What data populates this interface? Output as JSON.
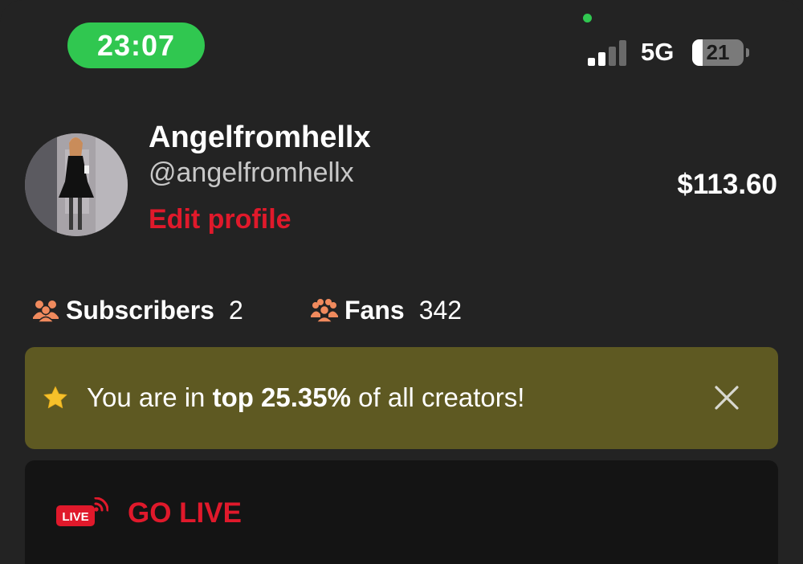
{
  "status_bar": {
    "time": "23:07",
    "network": "5G",
    "battery_level": "21",
    "battery_fraction": 0.21,
    "signal_bars_active": 2,
    "signal_bars_total": 4
  },
  "profile": {
    "display_name": "Angelfromhellx",
    "handle": "@angelfromhellx",
    "edit_label": "Edit profile",
    "balance": "$113.60"
  },
  "stats": {
    "subscribers_label": "Subscribers",
    "subscribers_count": "2",
    "fans_label": "Fans",
    "fans_count": "342"
  },
  "banner": {
    "prefix": "You are in ",
    "highlight": "top 25.35%",
    "suffix": " of all creators!",
    "icon": "star-icon"
  },
  "live": {
    "badge": "LIVE",
    "label": "GO LIVE"
  },
  "colors": {
    "background": "#232323",
    "accent_red": "#e0192b",
    "clock_green": "#30c750",
    "banner_olive": "#5e5922",
    "stat_icon_orange": "#f08a5d"
  }
}
